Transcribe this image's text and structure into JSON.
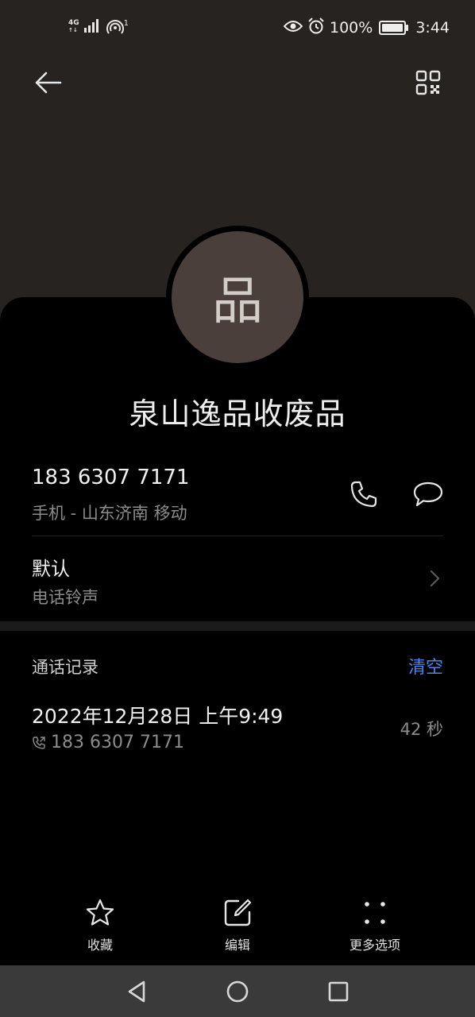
{
  "status_bar": {
    "network_top": "4G",
    "network_bottom": "↑↓",
    "hotspot_count": "1",
    "battery": "100%",
    "battery_level": 1.0,
    "time": "3:44"
  },
  "contact": {
    "avatar_initial": "品",
    "name": "泉山逸品收废品",
    "phone": "183 6307 7171",
    "phone_info": "手机 - 山东济南 移动"
  },
  "ringtone": {
    "title": "默认",
    "subtitle": "电话铃声"
  },
  "call_log": {
    "header": "通话记录",
    "clear_label": "清空",
    "entries": [
      {
        "time": "2022年12月28日 上午9:49",
        "number": "183 6307 7171",
        "duration": "42 秒"
      }
    ]
  },
  "actions": {
    "favorite": "收藏",
    "edit": "编辑",
    "more": "更多选项"
  },
  "colors": {
    "header_bg": "#262320",
    "avatar_bg": "#4a3f3a",
    "accent": "#4a86f0"
  }
}
